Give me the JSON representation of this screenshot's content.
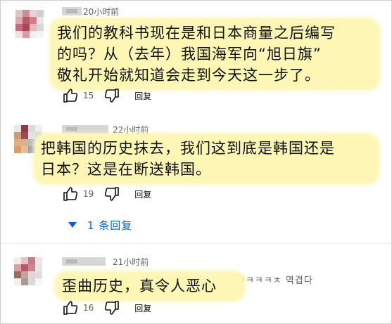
{
  "comments": [
    {
      "time": "20小时前",
      "overlay_lines": [
        "我们的教科书现在是和日本商量之后编写",
        "的吗？从（去年）我国海军向“旭日旗”",
        "敬礼开始就知道会走到今天这一步了。"
      ],
      "likes": "15",
      "reply_label": "回复"
    },
    {
      "time": "22小时前",
      "overlay_lines": [
        "把韩国的历史抹去，我们这到底是韩国还是",
        "日本？这是在断送韩国。"
      ],
      "likes": "19",
      "reply_label": "回复",
      "replies_toggle": "1 条回复"
    },
    {
      "time": "21小时前",
      "original_text": "ㅋㅋㅋㅋㅊ 역겹다",
      "overlay_lines": [
        "歪曲历史，真令人恶心"
      ],
      "likes": "16",
      "reply_label": "回复"
    }
  ],
  "icons": [
    "thumb-up-icon",
    "thumb-down-icon",
    "chevron-down-icon"
  ],
  "colors": {
    "overlay_bg": "#fdf6b4",
    "link_blue": "#065fd4",
    "meta_gray": "#606060"
  }
}
